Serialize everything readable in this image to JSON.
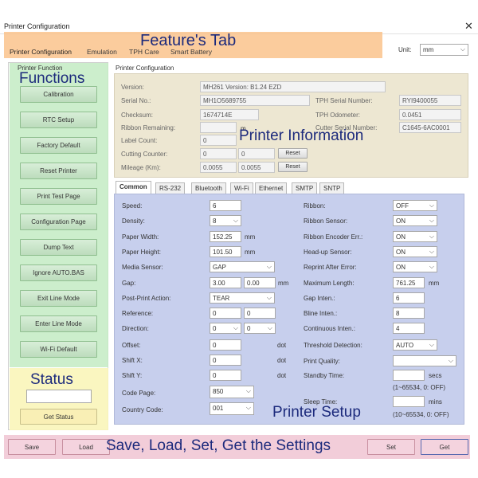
{
  "window": {
    "title": "Printer Configuration"
  },
  "tabs": [
    "Printer Configuration",
    "Emulation",
    "TPH Care",
    "Smart Battery"
  ],
  "unit": {
    "label": "Unit:",
    "value": "mm"
  },
  "annotations": {
    "feature_tab": "Feature's Tab",
    "functions": "Functions",
    "status": "Status",
    "printer_information": "Printer Information",
    "printer_setup": "Printer Setup",
    "save_load": "Save, Load, Set, Get the Settings"
  },
  "functions": {
    "group_label": "Printer Function",
    "buttons": [
      "Calibration",
      "RTC Setup",
      "Factory Default",
      "Reset Printer",
      "Print Test Page",
      "Configuration Page",
      "Dump Text",
      "Ignore AUTO.BAS",
      "Exit Line Mode",
      "Enter Line Mode",
      "Wi-Fi Default"
    ]
  },
  "status": {
    "get_status": "Get Status",
    "value": ""
  },
  "info": {
    "group_label": "Printer Configuration",
    "version_label": "Version:",
    "version": "MH261 Version: B1.24 EZD",
    "serial_label": "Serial No.:",
    "serial": "MH1O5689755",
    "checksum_label": "Checksum:",
    "checksum": "1674714E",
    "ribbon_remaining_label": "Ribbon Remaining:",
    "ribbon_remaining": "",
    "ribbon_unit": "m",
    "label_count_label": "Label Count:",
    "label_count": "0",
    "cutting_counter_label": "Cutting Counter:",
    "cutting_counter_a": "0",
    "cutting_counter_b": "0",
    "mileage_label": "Mileage (Km):",
    "mileage_a": "0.0055",
    "mileage_b": "0.0055",
    "reset": "Reset",
    "tph_serial_label": "TPH Serial Number:",
    "tph_serial": "RYI9400055",
    "tph_odometer_label": "TPH Odometer:",
    "tph_odometer": "0.0451",
    "cutter_serial_label": "Cutter Serial Number:",
    "cutter_serial": "C1645-6AC0001"
  },
  "subtabs": [
    "Common",
    "RS-232",
    "Bluetooth",
    "Wi-Fi",
    "Ethernet",
    "SMTP",
    "SNTP"
  ],
  "setup_left": {
    "speed_label": "Speed:",
    "speed": "6",
    "density_label": "Density:",
    "density": "8",
    "paper_width_label": "Paper Width:",
    "paper_width": "152.25",
    "paper_height_label": "Paper Height:",
    "paper_height": "101.50",
    "media_sensor_label": "Media Sensor:",
    "media_sensor": "GAP",
    "gap_label": "Gap:",
    "gap_a": "3.00",
    "gap_b": "0.00",
    "post_print_label": "Post-Print Action:",
    "post_print": "TEAR",
    "reference_label": "Reference:",
    "reference_a": "0",
    "reference_b": "0",
    "direction_label": "Direction:",
    "direction_a": "0",
    "direction_b": "0",
    "offset_label": "Offset:",
    "offset": "0",
    "shift_x_label": "Shift X:",
    "shift_x": "0",
    "shift_y_label": "Shift Y:",
    "shift_y": "0",
    "code_page_label": "Code Page:",
    "code_page": "850",
    "country_code_label": "Country Code:",
    "country_code": "001",
    "mm": "mm",
    "dot": "dot"
  },
  "setup_right": {
    "ribbon_label": "Ribbon:",
    "ribbon": "OFF",
    "ribbon_sensor_label": "Ribbon Sensor:",
    "ribbon_sensor": "ON",
    "ribbon_encoder_label": "Ribbon Encoder Err.:",
    "ribbon_encoder": "ON",
    "headup_label": "Head-up Sensor:",
    "headup": "ON",
    "reprint_label": "Reprint After Error:",
    "reprint": "ON",
    "max_length_label": "Maximum Length:",
    "max_length": "761.25",
    "gap_inten_label": "Gap Inten.:",
    "gap_inten": "6",
    "bline_inten_label": "Bline Inten.:",
    "bline_inten": "8",
    "cont_inten_label": "Continuous Inten.:",
    "cont_inten": "4",
    "threshold_label": "Threshold Detection:",
    "threshold": "AUTO",
    "print_quality_label": "Print Quality:",
    "print_quality": "",
    "standby_label": "Standby Time:",
    "standby": "",
    "secs": "secs",
    "standby_range": "(1~65534, 0: OFF)",
    "sleep_label": "Sleep Time:",
    "sleep": "",
    "mins": "mins",
    "sleep_range": "(10~65534, 0: OFF)",
    "mm": "mm"
  },
  "bottom": {
    "save": "Save",
    "load": "Load",
    "set": "Set",
    "get": "Get"
  }
}
